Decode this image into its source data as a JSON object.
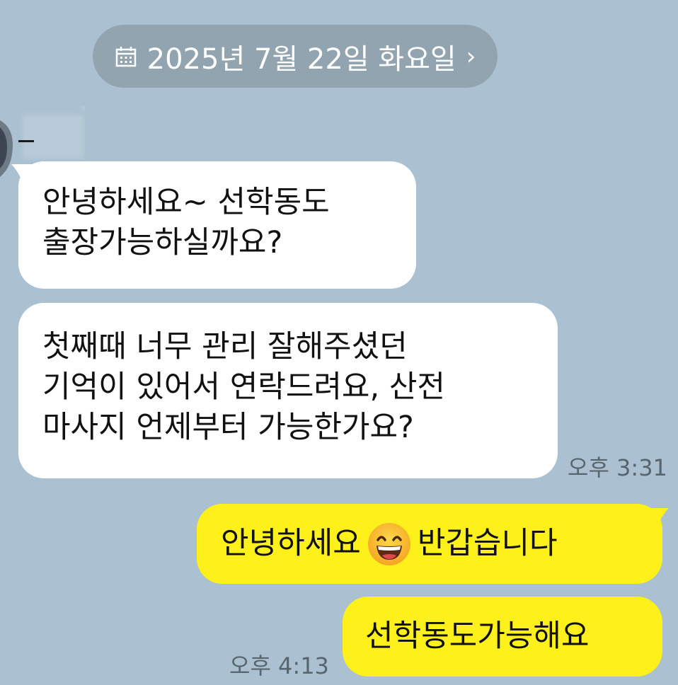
{
  "date_divider": {
    "label": "2025년 7월 22일 화요일",
    "icon": "calendar-icon",
    "chevron": "›"
  },
  "messages": [
    {
      "side": "received",
      "lines": [
        "안녕하세요~ 선학동도",
        "출장가능하실까요?"
      ]
    },
    {
      "side": "received",
      "lines": [
        "첫째때 너무 관리 잘해주셨던",
        "기억이 있어서 연락드려요, 산전",
        "마사지 언제부터 가능한가요?"
      ],
      "time": "오후 3:31"
    },
    {
      "side": "sent",
      "text_before": "안녕하세요",
      "emoji": "grinning-face-icon",
      "text_after": "반갑습니다"
    },
    {
      "side": "sent",
      "text": "선학동도가능해요",
      "time": "오후 4:13"
    }
  ],
  "colors": {
    "background": "#abc1d1",
    "received_bubble": "#ffffff",
    "sent_bubble": "#fef01b",
    "date_pill": "#93a4b1"
  }
}
